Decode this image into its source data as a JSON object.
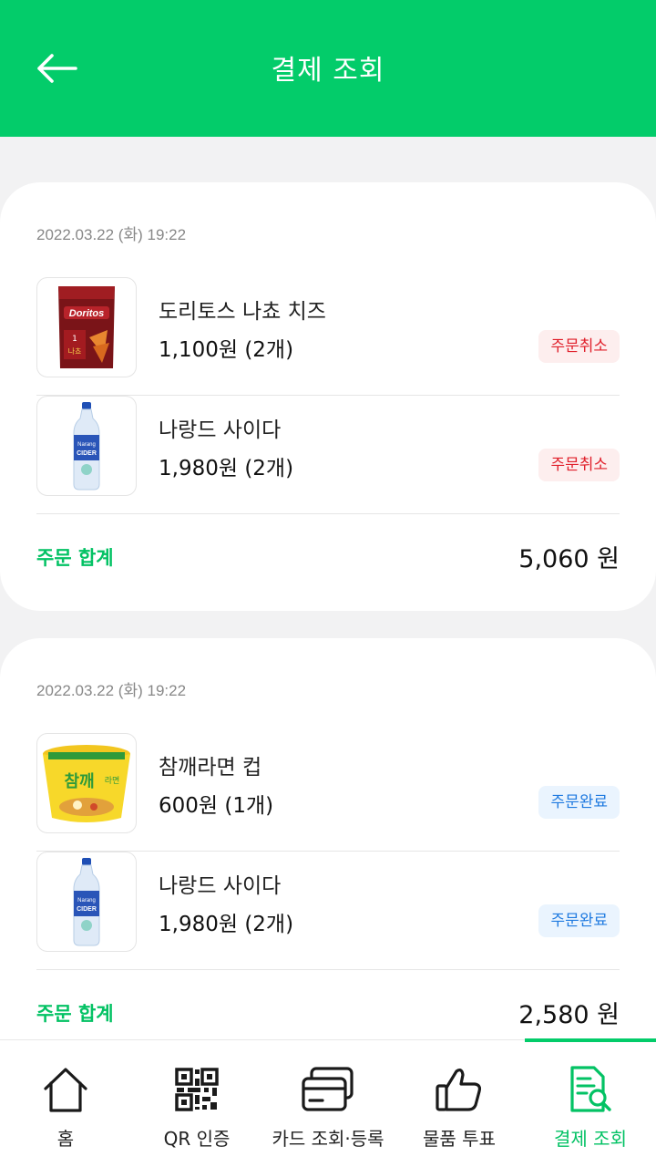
{
  "header": {
    "title": "결제 조회"
  },
  "orders": [
    {
      "date": "2022.03.22 (화) 19:22",
      "items": [
        {
          "name": "도리토스 나쵸 치즈",
          "price": "1,100원 (2개)",
          "status": "주문취소",
          "image": "doritos-bag"
        },
        {
          "name": "나랑드 사이다",
          "price": "1,980원 (2개)",
          "status": "주문취소",
          "image": "cider-bottle"
        }
      ],
      "total_label": "주문 합계",
      "total_value": "5,060 원"
    },
    {
      "date": "2022.03.22 (화) 19:22",
      "items": [
        {
          "name": "참깨라면 컵",
          "price": "600원 (1개)",
          "status": "주문완료",
          "image": "ramen-cup"
        },
        {
          "name": "나랑드 사이다",
          "price": "1,980원 (2개)",
          "status": "주문완료",
          "image": "cider-bottle"
        }
      ],
      "total_label": "주문 합계",
      "total_value": "2,580 원"
    }
  ],
  "nav": {
    "items": [
      {
        "label": "홈",
        "icon": "home-icon"
      },
      {
        "label": "QR 인증",
        "icon": "qr-code-icon"
      },
      {
        "label": "카드 조회·등록",
        "icon": "credit-card-icon"
      },
      {
        "label": "물품 투표",
        "icon": "thumbs-up-icon"
      },
      {
        "label": "결제 조회",
        "icon": "receipt-search-icon"
      }
    ],
    "active_index": 4
  },
  "colors": {
    "brand_green": "#03cc6a",
    "cancel_red": "#e0202b",
    "done_blue": "#1f7ae0"
  }
}
